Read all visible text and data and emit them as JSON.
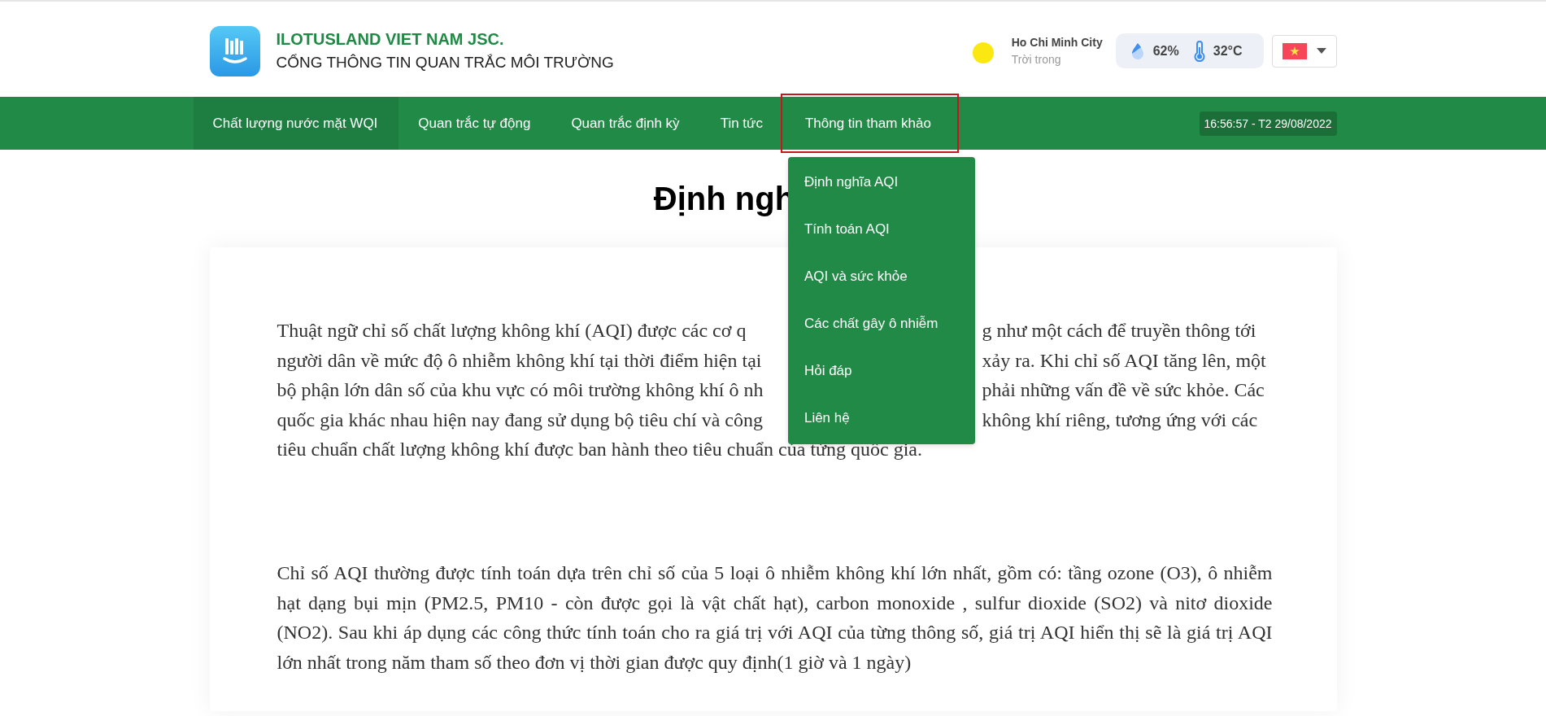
{
  "brand": {
    "company": "ILOTUSLAND VIET NAM JSC.",
    "subtitle": "CỔNG THÔNG TIN QUAN TRẮC MÔI TRƯỜNG"
  },
  "weather": {
    "city": "Ho Chi Minh City",
    "condition": "Trời trong",
    "humidity": "62%",
    "temperature": "32°C"
  },
  "nav": {
    "items": [
      {
        "label": "Chất lượng nước mặt WQI",
        "selected": true,
        "highlighted": false
      },
      {
        "label": "Quan trắc tự động",
        "selected": false,
        "highlighted": false
      },
      {
        "label": "Quan trắc định kỳ",
        "selected": false,
        "highlighted": false
      },
      {
        "label": "Tin tức",
        "selected": false,
        "highlighted": false
      },
      {
        "label": "Thông tin tham khảo",
        "selected": false,
        "highlighted": true,
        "expanded": true,
        "menu": [
          "Định nghĩa AQI",
          "Tính toán AQI",
          "AQI và sức khỏe",
          "Các chất gây ô nhiễm",
          "Hỏi đáp",
          "Liên hệ"
        ]
      }
    ],
    "clock": "16:56:57 - T2 29/08/2022"
  },
  "article": {
    "heading": "Định ngh",
    "paragraphs": [
      {
        "kind": "split",
        "lines": [
          {
            "left": "Thuật ngữ chỉ số chất lượng không khí (AQI) được các cơ q",
            "right": "g như một cách để truyền thông tới"
          },
          {
            "left": "người dân về mức độ ô nhiễm không khí tại thời điểm hiện tại",
            "right": "xảy ra. Khi chỉ số AQI tăng lên, một"
          },
          {
            "left": "bộ phận lớn dân số của khu vực có môi trường không khí ô nh",
            "right": "phải những vấn đề về sức khỏe. Các"
          },
          {
            "left": "quốc gia khác nhau hiện nay đang sử dụng bộ tiêu chí và công",
            "right": "không khí riêng, tương ứng với các"
          },
          {
            "text": "tiêu chuẩn chất lượng không khí được ban hành theo tiêu chuẩn của từng quốc gia."
          }
        ]
      },
      {
        "kind": "text",
        "text": "Chỉ số AQI thường được tính toán dựa trên chỉ số của 5 loại ô nhiễm không khí lớn nhất, gồm có: tầng ozone (O3), ô nhiễm hạt dạng bụi mịn (PM2.5, PM10 - còn được gọi là vật chất hạt), carbon monoxide , sulfur dioxide (SO2) và nitơ dioxide (NO2). Sau khi áp dụng các công thức tính toán cho ra giá trị với AQI của từng thông số, giá trị AQI hiển thị sẽ là giá trị AQI lớn nhất trong năm tham số theo đơn vị thời gian được quy định(1 giờ và 1 ngày)"
      }
    ]
  }
}
